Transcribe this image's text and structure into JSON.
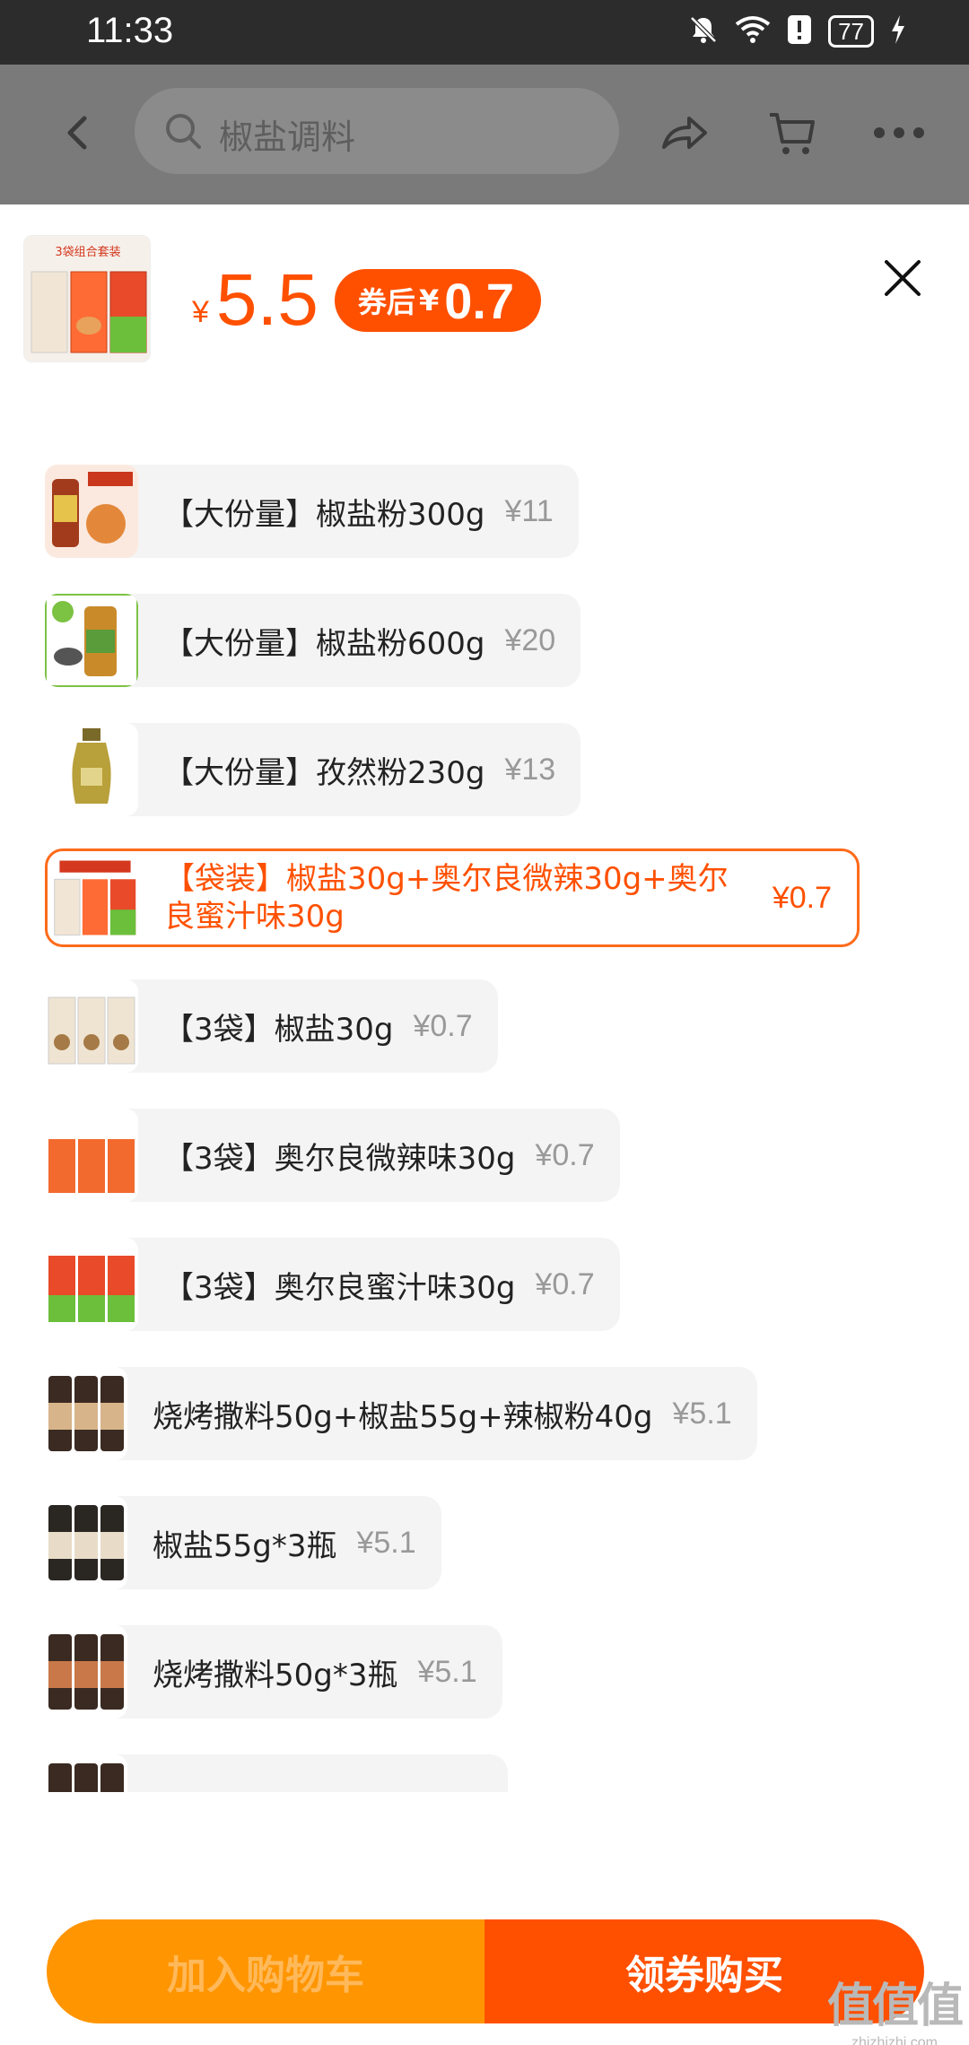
{
  "status_bar": {
    "time": "11:33",
    "battery": "77",
    "icons": [
      "bell-off-icon",
      "wifi-icon",
      "alert-icon",
      "battery-icon",
      "charging-icon"
    ]
  },
  "header": {
    "search_text": "椒盐调料",
    "icons": [
      "back-icon",
      "search-icon",
      "share-icon",
      "cart-icon",
      "more-icon"
    ]
  },
  "sheet": {
    "thumb_title": "3袋组合套装",
    "yen": "¥",
    "price": "5.5",
    "coupon_label": "券后",
    "coupon_yen": "¥",
    "coupon_price": "0.7"
  },
  "options": [
    {
      "name": "【大份量】椒盐粉300g",
      "price": "¥11",
      "selected": false
    },
    {
      "name": "【大份量】椒盐粉600g",
      "price": "¥20",
      "selected": false
    },
    {
      "name": "【大份量】孜然粉230g",
      "price": "¥13",
      "selected": false
    },
    {
      "name": "【袋装】椒盐30g+奥尔良微辣30g+奥尔良蜜汁味30g",
      "price": "¥0.7",
      "selected": true
    },
    {
      "name": "【3袋】椒盐30g",
      "price": "¥0.7",
      "selected": false
    },
    {
      "name": "【3袋】奥尔良微辣味30g",
      "price": "¥0.7",
      "selected": false
    },
    {
      "name": "【3袋】奥尔良蜜汁味30g",
      "price": "¥0.7",
      "selected": false
    },
    {
      "name": "烧烤撒料50g+椒盐55g+辣椒粉40g",
      "price": "¥5.1",
      "selected": false
    },
    {
      "name": "椒盐55g*3瓶",
      "price": "¥5.1",
      "selected": false
    },
    {
      "name": "烧烤撒料50g*3瓶",
      "price": "¥5.1",
      "selected": false
    },
    {
      "name": "",
      "price": "",
      "selected": false
    }
  ],
  "bottom": {
    "add_cart": "加入购物车",
    "buy": "领券购买"
  },
  "watermark": {
    "line1": "值值值",
    "line2": "zhizhizhi.com"
  },
  "colors": {
    "accent": "#ff5000",
    "cart_button": "#ff9500",
    "overlay": "#7a7a7a"
  }
}
